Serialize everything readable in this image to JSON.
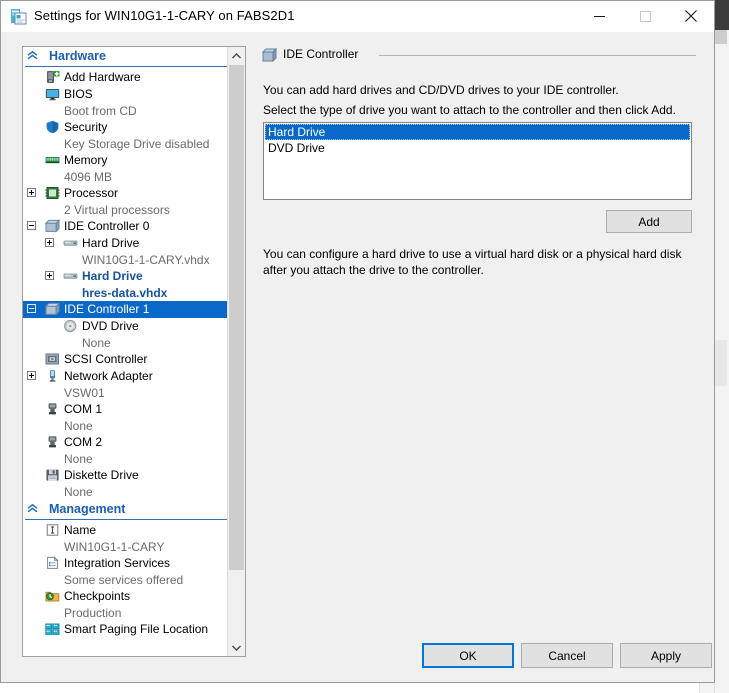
{
  "window": {
    "title": "Settings for WIN10G1-1-CARY on FABS2D1",
    "icon": "hyperv-settings-icon",
    "minimize_label": "Minimize",
    "maximize_label": "Maximize",
    "close_label": "Close"
  },
  "sidebar": {
    "sections": [
      {
        "id": "hardware",
        "label": "Hardware",
        "collapse_icon": "double-chevron-up-icon",
        "items": [
          {
            "label": "Add Hardware",
            "sub": "",
            "icon": "add-hardware-icon",
            "indent": 1,
            "expander": "none",
            "state": "normal"
          },
          {
            "label": "BIOS",
            "sub": "Boot from CD",
            "icon": "bios-monitor-icon",
            "indent": 1,
            "expander": "none",
            "state": "normal"
          },
          {
            "label": "Security",
            "sub": "Key Storage Drive disabled",
            "icon": "shield-icon",
            "indent": 1,
            "expander": "none",
            "state": "normal"
          },
          {
            "label": "Memory",
            "sub": "4096 MB",
            "icon": "memory-icon",
            "indent": 1,
            "expander": "none",
            "state": "normal"
          },
          {
            "label": "Processor",
            "sub": "2 Virtual processors",
            "icon": "processor-icon",
            "indent": 1,
            "expander": "plus",
            "state": "normal"
          },
          {
            "label": "IDE Controller 0",
            "sub": "",
            "icon": "ide-controller-icon",
            "indent": 1,
            "expander": "minus",
            "state": "normal"
          },
          {
            "label": "Hard Drive",
            "sub": "WIN10G1-1-CARY.vhdx",
            "icon": "hard-drive-icon",
            "indent": 2,
            "expander": "plus",
            "state": "normal"
          },
          {
            "label": "Hard Drive",
            "sub": "hres-data.vhdx",
            "icon": "hard-drive-icon",
            "indent": 2,
            "expander": "plus",
            "state": "modified"
          },
          {
            "label": "IDE Controller 1",
            "sub": "",
            "icon": "ide-controller-icon",
            "indent": 1,
            "expander": "minus",
            "state": "selected"
          },
          {
            "label": "DVD Drive",
            "sub": "None",
            "icon": "dvd-drive-icon",
            "indent": 2,
            "expander": "none",
            "state": "normal"
          },
          {
            "label": "SCSI Controller",
            "sub": "",
            "icon": "scsi-controller-icon",
            "indent": 1,
            "expander": "none",
            "state": "normal"
          },
          {
            "label": "Network Adapter",
            "sub": "VSW01",
            "icon": "network-adapter-icon",
            "indent": 1,
            "expander": "plus",
            "state": "normal"
          },
          {
            "label": "COM 1",
            "sub": "None",
            "icon": "com-port-icon",
            "indent": 1,
            "expander": "none",
            "state": "normal"
          },
          {
            "label": "COM 2",
            "sub": "None",
            "icon": "com-port-icon",
            "indent": 1,
            "expander": "none",
            "state": "normal"
          },
          {
            "label": "Diskette Drive",
            "sub": "None",
            "icon": "diskette-drive-icon",
            "indent": 1,
            "expander": "none",
            "state": "normal"
          }
        ]
      },
      {
        "id": "management",
        "label": "Management",
        "collapse_icon": "double-chevron-up-icon",
        "items": [
          {
            "label": "Name",
            "sub": "WIN10G1-1-CARY",
            "icon": "name-textbox-icon",
            "indent": 1,
            "expander": "none",
            "state": "normal"
          },
          {
            "label": "Integration Services",
            "sub": "Some services offered",
            "icon": "integration-services-icon",
            "indent": 1,
            "expander": "none",
            "state": "normal"
          },
          {
            "label": "Checkpoints",
            "sub": "Production",
            "icon": "checkpoints-icon",
            "indent": 1,
            "expander": "none",
            "state": "normal"
          },
          {
            "label": "Smart Paging File Location",
            "sub": "",
            "icon": "smart-paging-icon",
            "indent": 1,
            "expander": "none",
            "state": "normal"
          }
        ]
      }
    ],
    "scrollbar": {
      "up_icon": "chevron-up-icon",
      "down_icon": "chevron-down-icon"
    }
  },
  "main": {
    "group_title": "IDE Controller",
    "group_icon": "ide-controller-icon",
    "description_1": "You can add hard drives and CD/DVD drives to your IDE controller.",
    "description_2": "Select the type of drive you want to attach to the controller and then click Add.",
    "drive_types": [
      {
        "label": "Hard Drive",
        "selected": true
      },
      {
        "label": "DVD Drive",
        "selected": false
      }
    ],
    "add_label": "Add",
    "footer_note": "You can configure a hard drive to use a virtual hard disk or a physical hard disk after you attach the drive to the controller."
  },
  "footer": {
    "ok_label": "OK",
    "cancel_label": "Cancel",
    "apply_label": "Apply"
  },
  "colors": {
    "selection_blue": "#0a69c8",
    "section_blue": "#1a5fb4",
    "modified_blue": "#15539e",
    "dialog_face": "#f0f0f0",
    "focus_blue": "#0078d7"
  }
}
